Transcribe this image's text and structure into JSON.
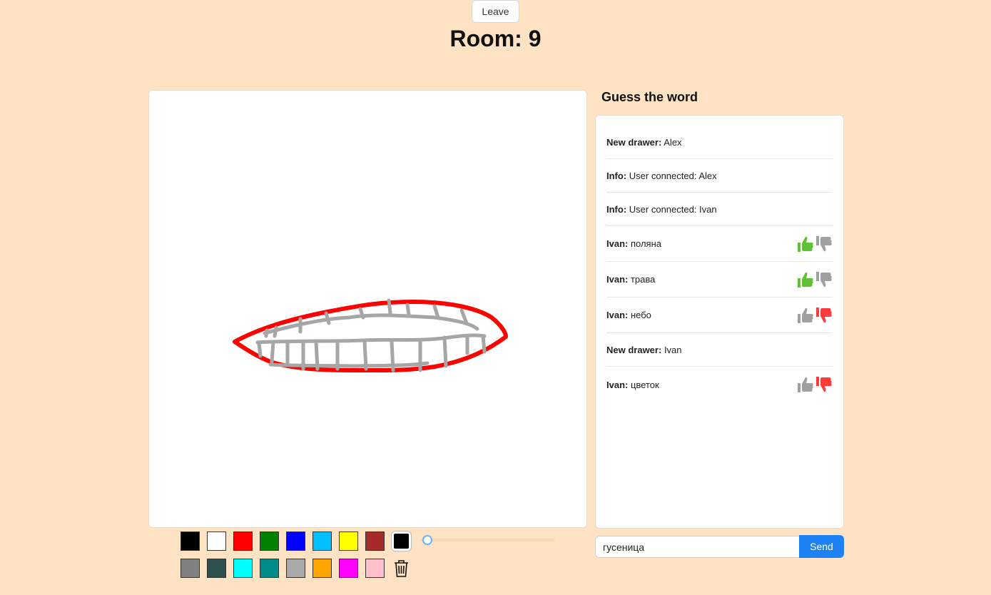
{
  "header": {
    "leave_label": "Leave",
    "room_title": "Room: 9"
  },
  "canvas": {
    "strokes": [
      {
        "color": "#ff0000",
        "kind": "outline"
      },
      {
        "color": "#a6a6a6",
        "kind": "teeth"
      }
    ]
  },
  "chat": {
    "heading": "Guess the word",
    "messages": [
      {
        "author": "New drawer:",
        "text": "Alex",
        "votes": null
      },
      {
        "author": "Info:",
        "text": "User connected: Alex",
        "votes": null
      },
      {
        "author": "Info:",
        "text": "User connected: Ivan",
        "votes": null
      },
      {
        "author": "Ivan:",
        "text": "поляна",
        "votes": "up"
      },
      {
        "author": "Ivan:",
        "text": "трава",
        "votes": "up"
      },
      {
        "author": "Ivan:",
        "text": "небо",
        "votes": "down"
      },
      {
        "author": "New drawer:",
        "text": "Ivan",
        "votes": null
      },
      {
        "author": "Ivan:",
        "text": "цветок",
        "votes": "down"
      }
    ],
    "input_value": "гусеница",
    "send_label": "Send"
  },
  "palette": {
    "row1": [
      "#000000",
      "#ffffff",
      "#ff0000",
      "#008000",
      "#0000ff",
      "#00bfff",
      "#ffff00",
      "#a52a2a"
    ],
    "row2": [
      "#808080",
      "#2f4f4f",
      "#00ffff",
      "#008b8b",
      "#a9a9a9",
      "#ffa500",
      "#ff00ff",
      "#ffc0cb"
    ],
    "selected_color": "#000000",
    "brush_size_fraction": 0.0
  },
  "icons": {
    "trash": "trash-icon",
    "thumb_up": "thumbs-up-icon",
    "thumb_down": "thumbs-down-icon"
  },
  "colors": {
    "background": "#fde3c3",
    "send_button": "#1e82f7",
    "vote_up_active": "#5ec234",
    "vote_down_active": "#ff3b3b",
    "vote_inactive": "#a0a0a0"
  }
}
